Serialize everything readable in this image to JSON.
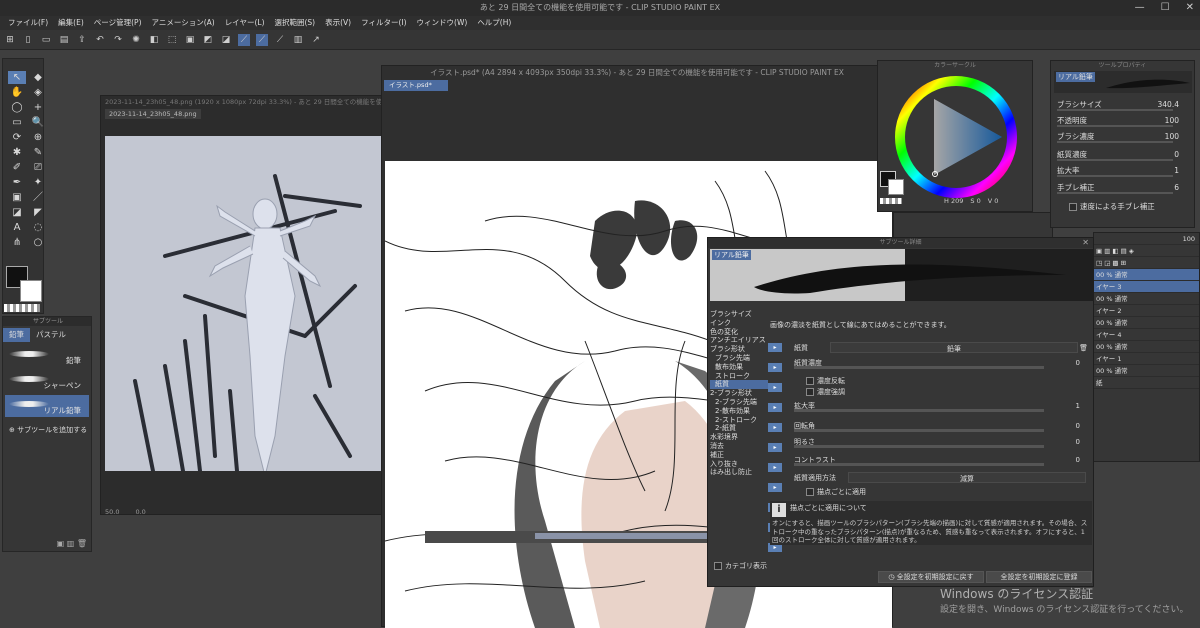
{
  "app": {
    "title": "あと 29 日間全ての機能を使用可能です - CLIP STUDIO PAINT EX",
    "minimize": "—",
    "maximize": "☐",
    "close": "✕"
  },
  "menu": [
    "ファイル(F)",
    "編集(E)",
    "ページ管理(P)",
    "アニメーション(A)",
    "レイヤー(L)",
    "選択範囲(S)",
    "表示(V)",
    "フィルター(I)",
    "ウィンドウ(W)",
    "ヘルプ(H)"
  ],
  "toolbar_icons": [
    "app-icon",
    "new-icon",
    "open-icon",
    "save-icon",
    "export-icon",
    "undo-icon",
    "redo-icon",
    "settings-icon",
    "fill-icon",
    "transform-icon",
    "select-icon",
    "deselect-icon",
    "invert-icon",
    "ruler-icon",
    "ruler-snap-icon",
    "ruler-pen-icon",
    "doc-icon",
    "exit-icon"
  ],
  "toolbox": {
    "tools": [
      "↖",
      "◆",
      "✋",
      "◈",
      "◯",
      "+",
      "▭",
      "🔍",
      "⟳",
      "⊕",
      "✱",
      "✎",
      "✐",
      "⎚",
      "✒",
      "✦",
      "▣",
      "／",
      "◪",
      "◤",
      "A",
      "◌",
      "⋔",
      "○"
    ],
    "colors": {
      "foreground": "#111111",
      "background": "#ffffff"
    }
  },
  "subtool": {
    "header": "サブツール",
    "tabs": [
      "鉛筆",
      "パステル"
    ],
    "brushes": [
      {
        "label": "鉛筆",
        "selected": false
      },
      {
        "label": "シャーペン",
        "selected": false
      },
      {
        "label": "リアル鉛筆",
        "selected": true
      }
    ],
    "add_label": "サブツールを追加する"
  },
  "reference_window": {
    "title": "2023-11-14_23h05_48.png (1920 x 1080px 72dpi 33.3%) - あと 29 日間全ての機能を使...",
    "tab": "2023-11-14_23h05_48.png",
    "footer": [
      "50.0",
      "0.0"
    ]
  },
  "main_window": {
    "title": "イラスト.psd* (A4 2894 x 4093px 350dpi 33.3%) - あと 29 日間全ての機能を使用可能です - CLIP STUDIO PAINT EX",
    "tab": "イラスト.psd*"
  },
  "color_wheel": {
    "header": "カラーサークル",
    "values": [
      "H 209",
      "S 0",
      "V 0"
    ]
  },
  "tool_property": {
    "header": "ツールプロパティ",
    "name": "リアル鉛筆",
    "rows": [
      {
        "label": "ブラシサイズ",
        "value": "340.4"
      },
      {
        "label": "不透明度",
        "value": "100"
      },
      {
        "label": "ブラシ濃度",
        "value": "100"
      },
      {
        "label": "紙質濃度",
        "value": "0"
      },
      {
        "label": "拡大率",
        "value": "1"
      },
      {
        "label": "手ブレ補正",
        "value": "6"
      }
    ],
    "stabilize_label": "速度による手ブレ補正"
  },
  "layers": {
    "rows": [
      "00 % 通常",
      "イヤー 3",
      "00 % 通常",
      "イヤー 2",
      "00 % 通常",
      "イヤー 4",
      "00 % 通常",
      "イヤー 1",
      "00 % 通常",
      "紙"
    ],
    "opacity": "100"
  },
  "sub_detail": {
    "header": "サブツール詳細",
    "name": "リアル鉛筆",
    "categories": [
      "ブラシサイズ",
      "インク",
      "色の変化",
      "アンチエイリアス",
      "ブラシ形状",
      "ブラシ先端",
      "散布効果",
      "ストローク",
      "紙質",
      "2-ブラシ形状",
      "2-ブラシ先端",
      "2-散布効果",
      "2-ストローク",
      "2-紙質",
      "水彩境界",
      "消去",
      "補正",
      "入り抜き",
      "はみ出し防止"
    ],
    "selected_category": 8,
    "description": "画像の濃淡を紙質として線にあてはめることができます。",
    "paper_label": "紙質",
    "paper_value": "鉛筆",
    "paper_density_label": "紙質濃度",
    "paper_density_value": "0",
    "invert_label": "濃度反転",
    "emphasis_label": "濃度強調",
    "scale_label": "拡大率",
    "scale_value": "1",
    "rotation_label": "回転角",
    "rotation_value": "0",
    "brightness_label": "明るさ",
    "brightness_value": "0",
    "contrast_label": "コントラスト",
    "contrast_value": "0",
    "apply_label": "紙質適用方法",
    "apply_value": "減算",
    "perdab_label": "描点ごとに適用",
    "info_title": "描点ごとに適用について",
    "info_text": "オンにすると、描画ツールのブラシパターン(ブラシ先端の描画)に対して質感が適用されます。その場合、ストローク中の重なったブラシパターン(描点)が重なるため、質感も重なって表示されます。オフにすると、1回のストローク全体に対して質感が適用されます。",
    "category_display": "カテゴリ表示",
    "reset_button": "全設定を初期設定に戻す",
    "register_button": "全設定を初期設定に登録"
  },
  "watermark": {
    "line1": "Windows のライセンス認証",
    "line2": "設定を開き、Windows のライセンス認証を行ってください。"
  }
}
